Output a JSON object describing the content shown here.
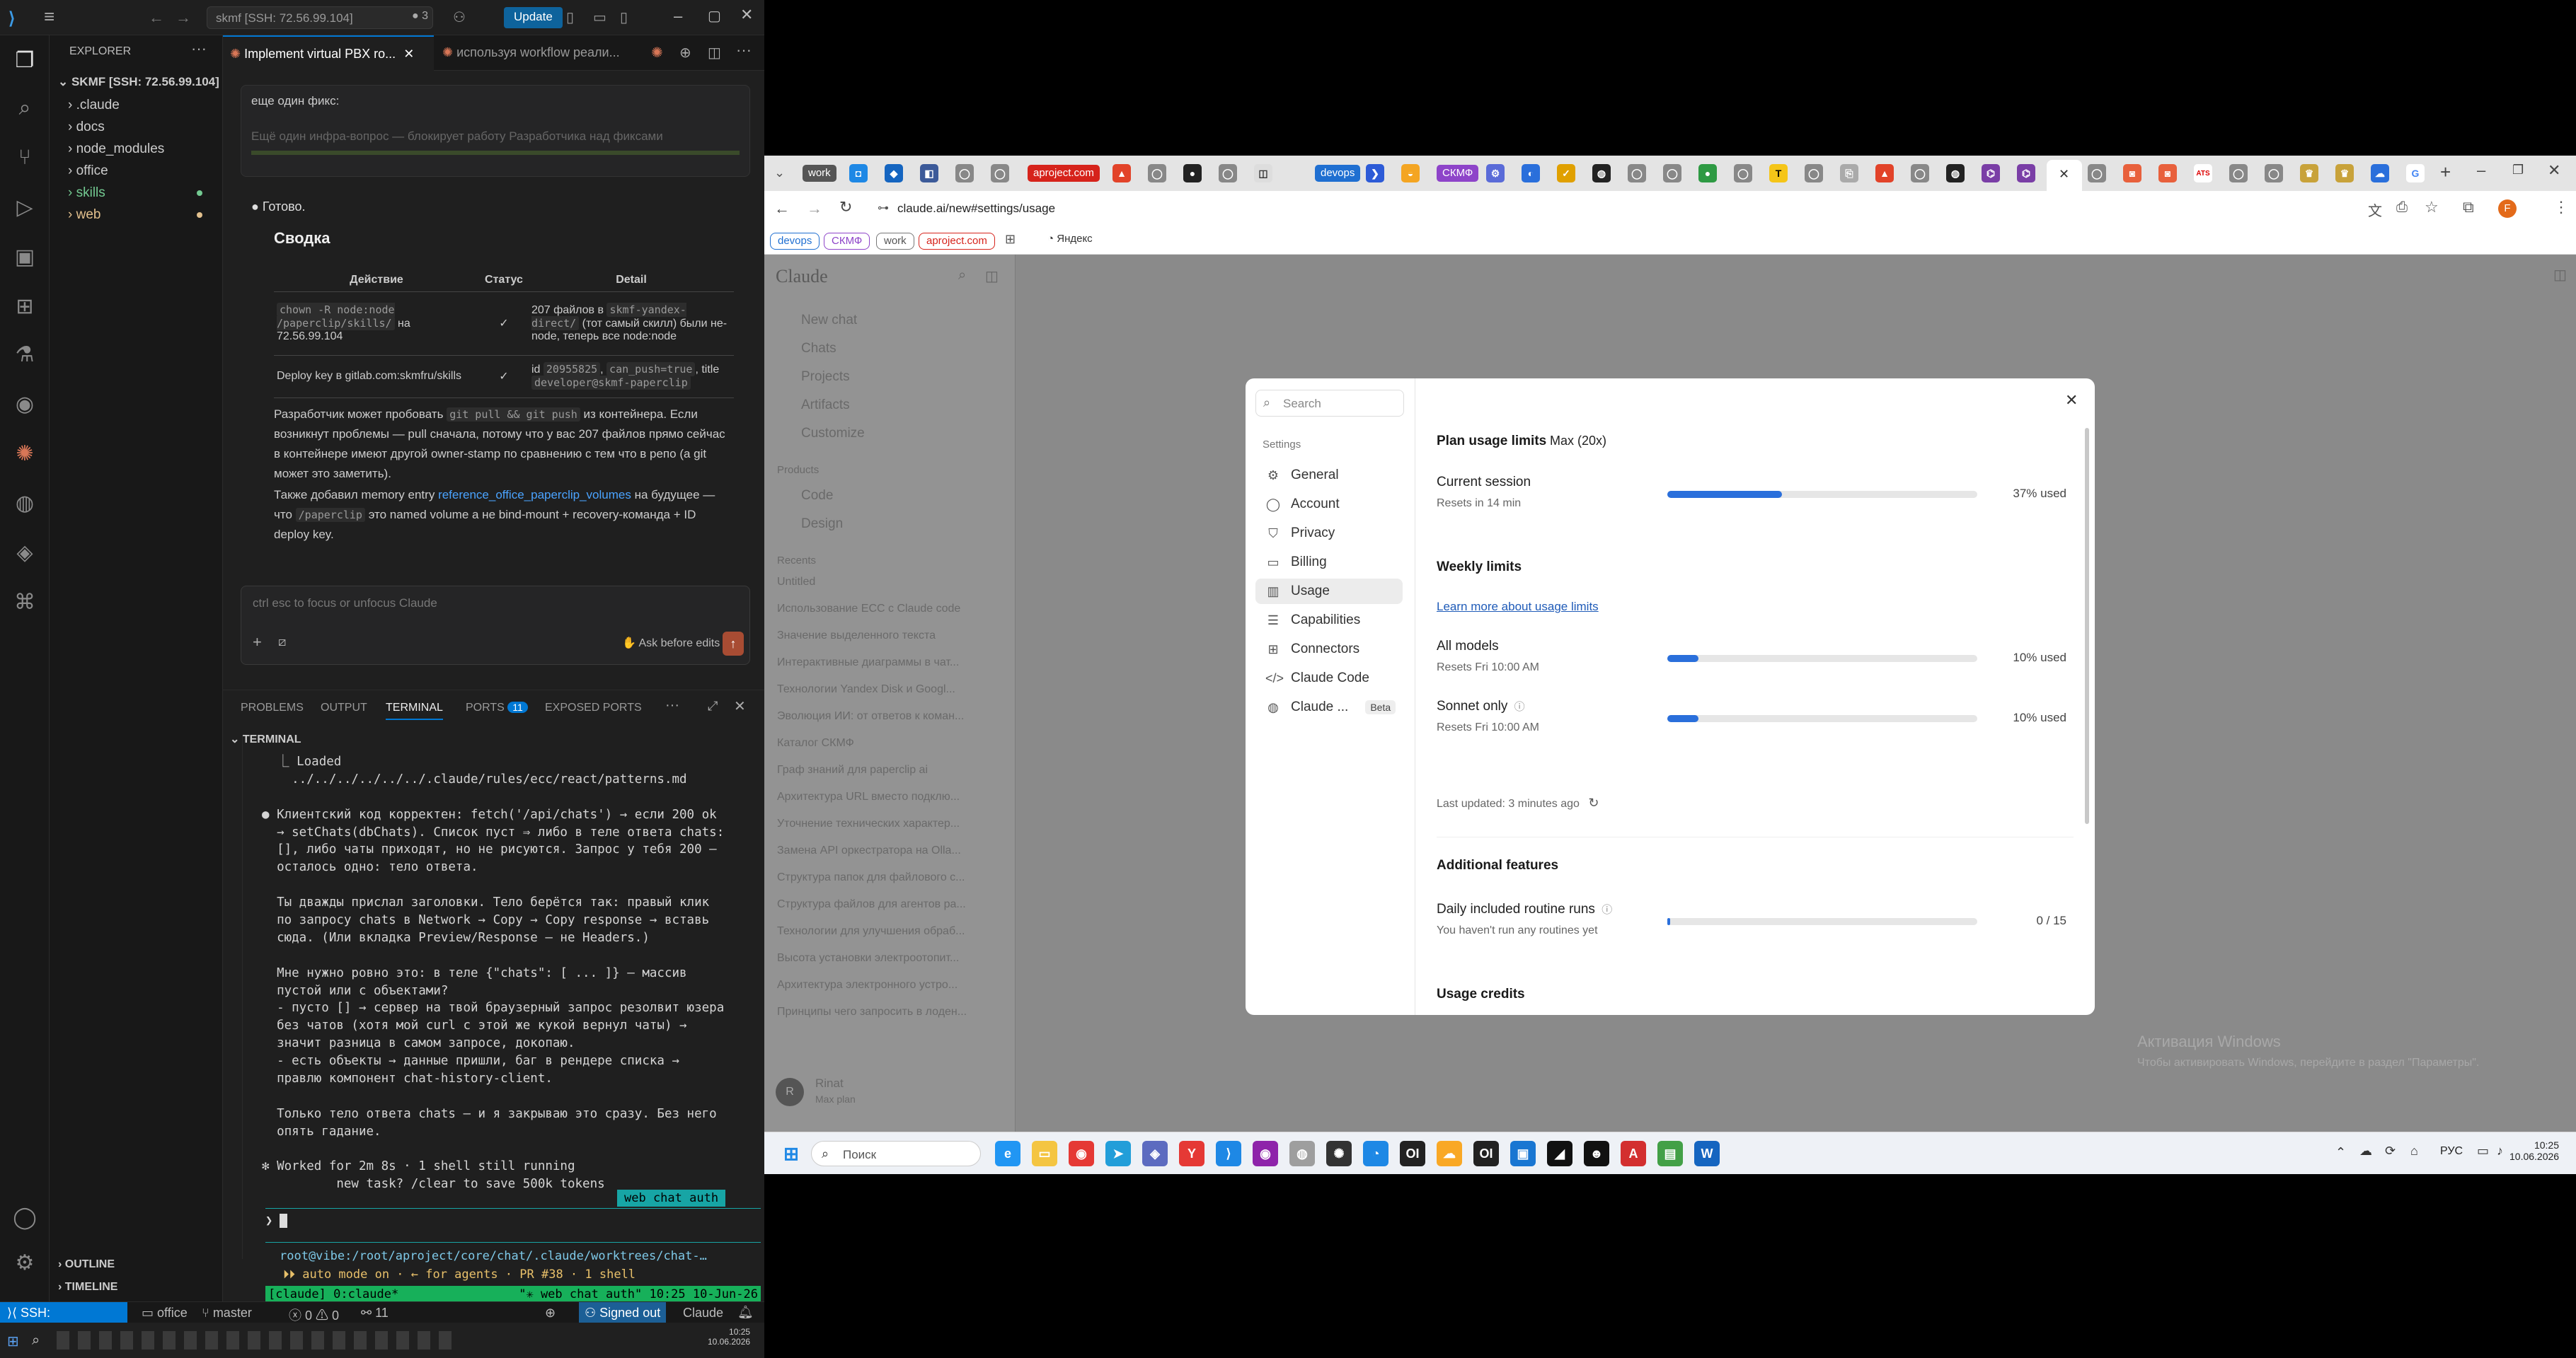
{
  "vscode": {
    "title_search": "skmf [SSH: 72.56.99.104]",
    "badge_count": "3",
    "update_label": "Update",
    "explorer_label": "EXPLORER",
    "root_label": "SKMF [SSH: 72.56.99.104]",
    "tree": [
      ".claude",
      "docs",
      "node_modules",
      "office",
      "skills",
      "web"
    ],
    "outline_label": "OUTLINE",
    "timeline_label": "TIMELINE",
    "tabs": [
      "Implement virtual PBX ro...",
      "используя workflow реали..."
    ],
    "chat": {
      "user_msg": "еще один фикс:",
      "user_msg_faded": "Ещё один инфра-вопрос — блокирует работу Разработчика над фиксами",
      "done": "Готово.",
      "summary_title": "Сводка",
      "table_headers": [
        "Действие",
        "Статус",
        "Detail"
      ],
      "row1_action_code": "chown -R node:node /paperclip/skills/",
      "row1_action_text": "на 72.56.99.104",
      "row1_status": "✓",
      "row1_detail_a": "207 файлов в",
      "row1_detail_code": "skmf-yandex-direct/",
      "row1_detail_b": "(тот самый скилл) были не-node, теперь все node:node",
      "row2_action": "Deploy key в gitlab.com:skmfru/skills",
      "row2_status": "✓",
      "row2_detail_a": "id",
      "row2_detail_code1": "20955825",
      "row2_detail_code2": "can_push=true",
      "row2_detail_b": "title",
      "row2_detail_code3": "developer@skmf-paperclip",
      "para1_a": "Разработчик может пробовать",
      "para1_code": "git pull && git push",
      "para1_b": "из контейнера. Если возникнут проблемы — pull сначала, потому что у вас 207 файлов прямо сейчас в контейнере имеют другой owner-stamp по сравнению с тем что в репо (а git может это заметить).",
      "para2_a": "Также добавил memory entry",
      "para2_link": "reference_office_paperclip_volumes",
      "para2_b": "на будущее — что",
      "para2_code": "/paperclip",
      "para2_c": "это named volume а не bind-mount + recovery-команда + ID deploy key.",
      "input_placeholder": "ctrl esc to focus or unfocus Claude",
      "ask_before_edits": "Ask before edits"
    },
    "panel_tabs": [
      "PROBLEMS",
      "OUTPUT",
      "TERMINAL",
      "PORTS",
      "EXPOSED PORTS"
    ],
    "ports_count": "11",
    "terminal_label": "TERMINAL",
    "terminal_lines": [
      "  ⎿ Loaded",
      "    ../../../../../../.claude/rules/ecc/react/patterns.md",
      "",
      "● Клиентский код корректен: fetch('/api/chats') → если 200 ok",
      "  → setChats(dbChats). Список пуст ⇒ либо в теле ответа chats:",
      "  [], либо чаты приходят, но не рисуются. Запрос у тебя 200 —",
      "  осталось одно: тело ответа.",
      "",
      "  Ты дважды прислал заголовки. Тело берётся так: правый клик",
      "  по запросу chats в Network → Copy → Copy response → вставь",
      "  сюда. (Или вкладка Preview/Response — не Headers.)",
      "",
      "  Мне нужно ровно это: в теле {\"chats\": [ ... ]} — массив",
      "  пустой или с объектами?",
      "  - пусто [] → сервер на твой браузерный запрос резолвит юзера",
      "  без чатов (хотя мой curl с этой же кукой вернул чаты) →",
      "  значит разница в самом запросе, докопаю.",
      "  - есть объекты → данные пришли, баг в рендере списка →",
      "  правлю компонент chat-history-client.",
      "",
      "  Только тело ответа chats — и я закрываю это сразу. Без него",
      "  опять гадание.",
      "",
      "✻ Worked for 2m 8s · 1 shell still running",
      "          new task? /clear to save 500k tokens"
    ],
    "term_tag": "web chat auth",
    "prompt_path": "root@vibe:/root/aproject/core/chat/.claude/worktrees/chat-…",
    "auto_mode": "⏵⏵ auto mode on · ← for agents · PR #38 · 1 shell",
    "tmux_left": "[claude] 0:claude*",
    "tmux_right": "\"✳ web chat auth\" 10:25 10-Jun-26",
    "status": {
      "ssh": "SSH: 72.56.99.104",
      "folder": "office",
      "branch": "master",
      "errors": "0",
      "warnings": "0",
      "ports": "11",
      "signed": "Signed out",
      "claude": "Claude"
    },
    "clock_time": "10:25",
    "clock_date": "10.06.2026"
  },
  "browser": {
    "tab_labels": [
      "work",
      "aproject.com",
      "devops",
      "СКМФ"
    ],
    "url": "claude.ai/new#settings/usage",
    "bookmarks": [
      "devops",
      "СКМФ",
      "work",
      "aproject.com"
    ],
    "yandex": "Яндекс",
    "colors": {
      "accent": "#2a6fdb",
      "aproject": "#d6231b",
      "devops": "#1f6fd1",
      "skmf": "#8e44c9",
      "work": "#555555"
    }
  },
  "claude": {
    "brand": "Claude",
    "nav": [
      "New chat",
      "Chats",
      "Projects",
      "Artifacts",
      "Customize"
    ],
    "products_label": "Products",
    "products": [
      "Code",
      "Design"
    ],
    "recents_label": "Recents",
    "recents": [
      "Untitled",
      "Использование ECC с Claude code",
      "Значение выделенного текста",
      "Интерактивные диаграммы в чат...",
      "Технологии Yandex Disk и Googl...",
      "Эволюция ИИ: от ответов к коман...",
      "Каталог СКМФ",
      "Граф знаний для paperclip ai",
      "Архитектура URL вместо подклю...",
      "Уточнение технических характер...",
      "Замена API оркестратора на Olla...",
      "Структура папок для файлового с...",
      "Структура файлов для агентов ра...",
      "Технологии для улучшения обраб...",
      "Высота установки электроотопит...",
      "Архитектура электронного устро...",
      "Принципы чего запросить в лоден..."
    ],
    "user_name": "Rinat",
    "user_plan": "Max plan",
    "watermark_title": "Активация Windows",
    "watermark_sub": "Чтобы активировать Windows, перейдите в раздел \"Параметры\"."
  },
  "settings": {
    "search_placeholder": "Search",
    "section": "Settings",
    "nav": [
      "General",
      "Account",
      "Privacy",
      "Billing",
      "Usage",
      "Capabilities",
      "Connectors",
      "Claude Code",
      "Claude ..."
    ],
    "beta": "Beta",
    "plan_title": "Plan usage limits",
    "plan_name": "Max (20x)",
    "current_session": "Current session",
    "current_resets": "Resets in 14 min",
    "current_pct": "37% used",
    "current_value": 0.37,
    "weekly_title": "Weekly limits",
    "learn_more": "Learn more about usage limits",
    "all_models": "All models",
    "all_resets": "Resets Fri 10:00 AM",
    "all_pct": "10% used",
    "all_value": 0.1,
    "sonnet": "Sonnet only",
    "sonnet_resets": "Resets Fri 10:00 AM",
    "sonnet_pct": "10% used",
    "sonnet_value": 0.1,
    "last_updated": "Last updated: 3 minutes ago",
    "additional_title": "Additional features",
    "routine": "Daily included routine runs",
    "routine_sub": "You haven't run any routines yet",
    "routine_count": "0 / 15",
    "routine_value": 0.0,
    "credits_title": "Usage credits"
  },
  "taskbar": {
    "search": "Поиск",
    "lang": "РУС",
    "time": "10:25",
    "date": "10.06.2026"
  }
}
